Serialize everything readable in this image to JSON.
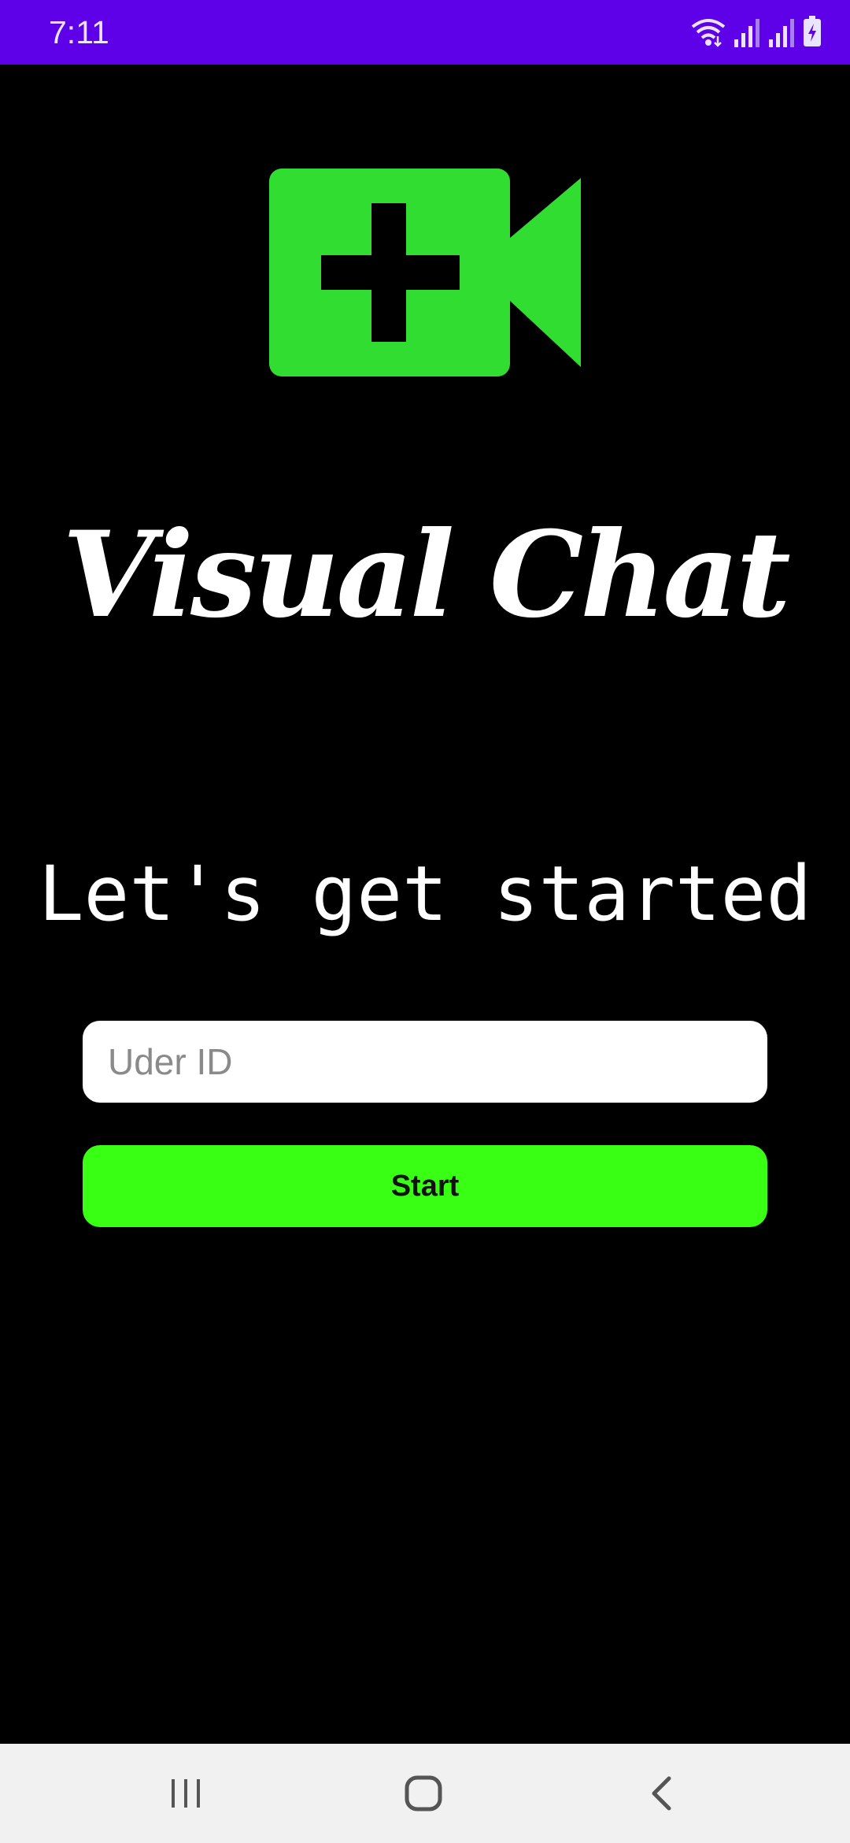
{
  "status_bar": {
    "time": "7:11",
    "icons": [
      "wifi-icon",
      "signal-icon",
      "signal-icon",
      "battery-charging-icon"
    ],
    "background": "#5e00e8"
  },
  "logo": {
    "icon": "video-call-add-icon",
    "color": "#32dd32"
  },
  "app_title": "Visual Chat",
  "subtitle": "Let's get started",
  "user_input": {
    "value": "",
    "placeholder": "Uder ID"
  },
  "start_button": {
    "label": "Start",
    "color": "#39ff14"
  },
  "nav_bar": {
    "items": [
      "recents-icon",
      "home-icon",
      "back-icon"
    ]
  }
}
